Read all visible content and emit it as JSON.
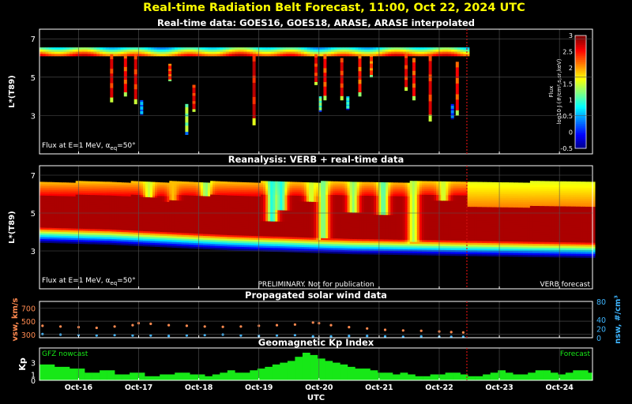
{
  "title": "Real-time Radiation Belt Forecast, 11:00, Oct 22, 2024 UTC",
  "colors": {
    "title": "#ffff00",
    "background": "#000000",
    "axes": "#ffffff",
    "grid": "#555555",
    "nowcast_line": "#d01010",
    "vsw_series": "#ff8a50",
    "nsw_series": "#3fb6ff",
    "kp_bars": "#17e817",
    "gfz_label": "#17e817",
    "forecast_label": "#17e817"
  },
  "x_axis": {
    "label": "UTC",
    "ticks": [
      "Oct-16",
      "Oct-17",
      "Oct-18",
      "Oct-19",
      "Oct-20",
      "Oct-21",
      "Oct-22",
      "Oct-23",
      "Oct-24"
    ],
    "tick_positions_days": [
      1,
      2,
      3,
      4,
      5,
      6,
      7,
      8,
      9
    ],
    "range_days": [
      0.35,
      9.55
    ],
    "start_date": "Oct-15",
    "now_day": 7.46
  },
  "colorbar": {
    "label_line1": "Flux",
    "label_line2": "log10 J (#/cm²,s,sr,keV)",
    "range": [
      -0.5,
      3
    ],
    "ticks": [
      "3",
      "2.5",
      "2",
      "1.5",
      "1",
      "0.5",
      "0",
      "-0.5"
    ],
    "tick_values": [
      3,
      2.5,
      2,
      1.5,
      1,
      0.5,
      0,
      -0.5
    ],
    "colormap": "jet"
  },
  "chart_data": [
    {
      "type": "heatmap",
      "title": "Real-time data: GOES16, GOES18, ARASE, ARASE interpolated",
      "ylabel": "L*(T89)",
      "ylim": [
        1,
        7.5
      ],
      "yticks": [
        3,
        5,
        7
      ],
      "annotation": "Flux at E=1 MeV, αeq=50°",
      "z_units": "log10 flux",
      "geo_band": {
        "L_range": [
          6.1,
          6.55
        ],
        "flux_bottom": 2.3,
        "flux_top": 0.9
      },
      "arase_passes": [
        {
          "day": 1.55,
          "L_low": 3.7,
          "L_high": 6.2,
          "flux": 2.7
        },
        {
          "day": 1.78,
          "L_low": 4.0,
          "L_high": 6.2,
          "flux": 2.6
        },
        {
          "day": 1.95,
          "L_low": 3.6,
          "L_high": 6.2,
          "flux": 2.7
        },
        {
          "day": 2.05,
          "L_low": 3.0,
          "L_high": 3.8,
          "flux": 0.6
        },
        {
          "day": 2.52,
          "L_low": 4.8,
          "L_high": 5.7,
          "flux": 2.5
        },
        {
          "day": 2.8,
          "L_low": 2.0,
          "L_high": 3.6,
          "flux": 1.5
        },
        {
          "day": 2.92,
          "L_low": 3.2,
          "L_high": 4.6,
          "flux": 2.7
        },
        {
          "day": 3.92,
          "L_low": 2.5,
          "L_high": 6.2,
          "flux": 2.8
        },
        {
          "day": 4.95,
          "L_low": 4.6,
          "L_high": 6.2,
          "flux": 2.7
        },
        {
          "day": 5.02,
          "L_low": 3.2,
          "L_high": 4.0,
          "flux": 1.3
        },
        {
          "day": 5.1,
          "L_low": 3.8,
          "L_high": 6.2,
          "flux": 2.6
        },
        {
          "day": 5.38,
          "L_low": 3.8,
          "L_high": 6.0,
          "flux": 2.7
        },
        {
          "day": 5.48,
          "L_low": 3.3,
          "L_high": 4.0,
          "flux": 1.0
        },
        {
          "day": 5.68,
          "L_low": 4.0,
          "L_high": 6.2,
          "flux": 2.5
        },
        {
          "day": 5.87,
          "L_low": 5.0,
          "L_high": 6.2,
          "flux": 2.4
        },
        {
          "day": 6.45,
          "L_low": 4.3,
          "L_high": 6.2,
          "flux": 2.7
        },
        {
          "day": 6.58,
          "L_low": 3.8,
          "L_high": 6.0,
          "flux": 2.6
        },
        {
          "day": 6.85,
          "L_low": 2.7,
          "L_high": 6.2,
          "flux": 2.7
        },
        {
          "day": 7.22,
          "L_low": 2.8,
          "L_high": 3.6,
          "flux": 0.4
        },
        {
          "day": 7.3,
          "L_low": 3.0,
          "L_high": 5.8,
          "flux": 2.6
        }
      ]
    },
    {
      "type": "heatmap",
      "title": "Reanalysis: VERB + real-time data",
      "ylabel": "L*(T89)",
      "ylim": [
        1,
        7.5
      ],
      "yticks": [
        3,
        5,
        7
      ],
      "annotation": "Flux at E=1 MeV, αeq=50°",
      "watermark": "PRELIMINARY. Not for publication",
      "forecast_label": "VERB forecast",
      "z_units": "log10 flux",
      "inner_edge_L": [
        {
          "day": 0.35,
          "L": 3.95
        },
        {
          "day": 1.5,
          "L": 3.85
        },
        {
          "day": 2.5,
          "L": 3.7
        },
        {
          "day": 3.5,
          "L": 3.55
        },
        {
          "day": 4.5,
          "L": 3.45
        },
        {
          "day": 5.5,
          "L": 3.35
        },
        {
          "day": 6.5,
          "L": 3.3
        },
        {
          "day": 7.46,
          "L": 3.25
        },
        {
          "day": 9.55,
          "L": 3.15
        }
      ],
      "core_flux": 3.0,
      "outer_edge_L": 6.6,
      "dropouts": [
        {
          "day": 2.15,
          "L_low": 5.8,
          "flux": 1.5
        },
        {
          "day": 2.55,
          "L_low": 5.6,
          "flux": 1.9
        },
        {
          "day": 3.1,
          "L_low": 5.9,
          "flux": 1.3
        },
        {
          "day": 4.2,
          "L_low": 4.5,
          "flux": 0.9
        },
        {
          "day": 4.35,
          "L_low": 5.1,
          "flux": 0.9
        },
        {
          "day": 4.85,
          "L_low": 5.6,
          "flux": 1.5
        },
        {
          "day": 5.05,
          "L_low": 3.6,
          "flux": 1.2
        },
        {
          "day": 5.55,
          "L_low": 5.0,
          "flux": 1.3
        },
        {
          "day": 6.05,
          "L_low": 4.9,
          "flux": 1.1
        },
        {
          "day": 6.55,
          "L_low": 3.4,
          "flux": 1.4
        },
        {
          "day": 7.05,
          "L_low": 5.6,
          "flux": 1.5
        }
      ]
    },
    {
      "type": "scatter",
      "title": "Propagated solar wind data",
      "ylabel": "vsw, km/s",
      "y2label": "nsw, #/cm³",
      "ylim": [
        250,
        800
      ],
      "yticks": [
        300,
        500,
        700
      ],
      "y2lim": [
        0,
        80
      ],
      "y2ticks": [
        0,
        20,
        40,
        80
      ],
      "series": [
        {
          "name": "vsw",
          "axis": "left",
          "x": [
            0.4,
            0.7,
            1.0,
            1.3,
            1.6,
            1.9,
            2.0,
            2.2,
            2.5,
            2.8,
            3.1,
            3.4,
            3.7,
            4.0,
            4.3,
            4.6,
            4.9,
            5.0,
            5.2,
            5.5,
            5.8,
            6.1,
            6.4,
            6.7,
            7.0,
            7.2,
            7.4
          ],
          "values": [
            430,
            420,
            410,
            400,
            420,
            440,
            470,
            460,
            440,
            430,
            420,
            415,
            420,
            430,
            440,
            450,
            480,
            470,
            440,
            410,
            390,
            370,
            360,
            355,
            345,
            335,
            330
          ]
        },
        {
          "name": "nsw",
          "axis": "right",
          "x": [
            0.4,
            0.7,
            1.0,
            1.3,
            1.6,
            1.9,
            2.2,
            2.5,
            2.8,
            3.1,
            3.4,
            3.7,
            4.0,
            4.3,
            4.6,
            4.9,
            5.2,
            5.5,
            5.8,
            6.1,
            6.4,
            6.7,
            7.0,
            7.2,
            7.4
          ],
          "values": [
            8,
            7,
            6,
            5,
            6,
            5,
            5,
            4,
            5,
            6,
            7,
            5,
            4,
            5,
            6,
            3,
            3,
            4,
            4,
            3,
            2,
            3,
            2,
            2,
            2
          ]
        }
      ]
    },
    {
      "type": "bar",
      "title": "Geomagnetic Kp Index",
      "ylabel": "Kp",
      "ylim": [
        0,
        5.5
      ],
      "yticks": [
        0,
        1,
        3
      ],
      "left_label": "GFZ nowcast",
      "right_label": "Forecast",
      "bin_days": 0.125,
      "start_day": 0.35,
      "values": [
        2.7,
        2.7,
        2.3,
        2.3,
        2.0,
        2.0,
        1.3,
        1.3,
        1.7,
        1.7,
        1.0,
        1.0,
        1.3,
        1.3,
        0.7,
        0.7,
        1.0,
        1.0,
        1.3,
        1.3,
        1.0,
        1.0,
        0.7,
        1.0,
        1.3,
        1.7,
        1.3,
        1.3,
        1.7,
        2.0,
        2.3,
        2.7,
        3.0,
        3.3,
        4.0,
        4.7,
        4.3,
        3.7,
        3.3,
        3.0,
        2.7,
        2.3,
        2.0,
        2.0,
        1.7,
        1.3,
        1.3,
        1.0,
        1.3,
        1.0,
        0.7,
        0.7,
        1.0,
        1.0,
        1.3,
        1.3,
        1.0,
        0.7,
        0.7,
        1.0,
        1.3,
        1.7,
        1.3,
        1.0,
        1.0,
        1.3,
        1.7,
        1.7,
        1.3,
        1.0,
        1.3,
        1.7,
        1.7,
        1.3,
        1.3,
        1.3,
        1.3,
        1.3,
        1.3,
        1.3,
        1.3,
        1.3,
        1.3,
        1.3,
        1.3,
        1.3,
        1.3,
        1.3,
        1.3,
        1.3,
        1.3,
        1.3,
        1.3,
        1.3
      ]
    }
  ]
}
